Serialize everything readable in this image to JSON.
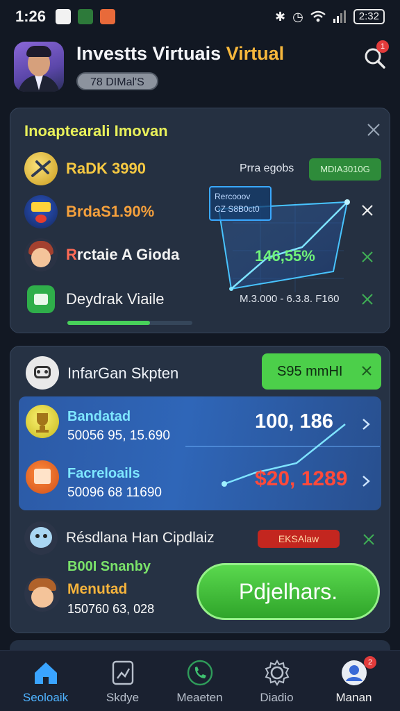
{
  "status_bar": {
    "time": "1:26",
    "battery": "2:32"
  },
  "header": {
    "title_main": "Investts Virtuais ",
    "title_accent": "Virtual",
    "balance": "78 DIMal'S",
    "notification_count": "1"
  },
  "card1": {
    "title": "Inoaptearali Imovan",
    "rows": [
      {
        "label": "RaDK 3990",
        "color": "#f5c842"
      },
      {
        "label": "BrdaS1.90%",
        "color": "#f5a03c"
      },
      {
        "label": "Rrctaie A Gioda",
        "color": "#f2f2f2"
      },
      {
        "label": "Deydrak Viaile",
        "color": "#f2f2f2"
      }
    ],
    "side_label_top": "Prra egobs",
    "chip_label": "MDIA3010G",
    "tooltip_line1": "Rercooov",
    "tooltip_line2": "CZ S8B0ct0",
    "percent": "146,55%",
    "range_label": "M.3.000 - 6.3.8. F160",
    "progress_fraction": 0.66
  },
  "card2": {
    "title": "InfarGan Skpten",
    "button_label": "S95 mmHI",
    "panel_rows": [
      {
        "title": "Bandatad",
        "sub": "50056 95, 15.690"
      },
      {
        "title": "Facreloails",
        "sub": "50096 68 11690"
      }
    ],
    "panel_value_1": "100, 186",
    "panel_value_2": "$20, 1289",
    "row3_label": "Résdlana Han Cipdlaiz",
    "row3_badge": "EKSAlaw",
    "row4_line1": "B00I Snanby",
    "row4_line2": "Menutad",
    "row4_line3": "150760 63, 028",
    "action_button": "Pdjelhars."
  },
  "bottom_nav": {
    "items": [
      {
        "label": "Seoloaik",
        "icon": "home-icon",
        "active": true
      },
      {
        "label": "Skdye",
        "icon": "chart-icon",
        "active": false
      },
      {
        "label": "Meaeten",
        "icon": "phone-icon",
        "active": false
      },
      {
        "label": "Diadio",
        "icon": "settings-icon",
        "active": false
      },
      {
        "label": "Manan",
        "icon": "profile-icon",
        "active": false
      }
    ],
    "badge": "2"
  },
  "colors": {
    "accent_yellow": "#f6b73c",
    "accent_green": "#4ccf4a",
    "accent_blue": "#4fb3ff",
    "accent_red": "#e23b3b"
  }
}
